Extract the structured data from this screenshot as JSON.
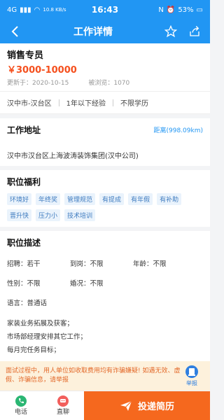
{
  "status": {
    "signal": "4G",
    "speed": "10.8 KB/s",
    "time": "16:43",
    "battery": "53%"
  },
  "nav": {
    "title": "工作详情"
  },
  "job": {
    "title": "销售专员",
    "salary": "￥3000-10000",
    "updated_label": "更新于：",
    "updated": "2020-10-15",
    "views_label": "被浏览：",
    "views": "1070",
    "tags": [
      "汉中市-汉台区",
      "1年以下经验",
      "不限学历"
    ]
  },
  "address": {
    "title": "工作地址",
    "distance": "距离(998.09km)",
    "text": "汉中市汉台区上海波涛装饰集团(汉中公司)"
  },
  "benefits": {
    "title": "职位福利",
    "items": [
      "环境好",
      "年终奖",
      "管理规范",
      "有提成",
      "有年假",
      "有补助",
      "晋升快",
      "压力小",
      "技术培训"
    ]
  },
  "description": {
    "title": "职位描述",
    "grid": [
      [
        "招聘：若干",
        "到岗：不限",
        "年龄：不限"
      ],
      [
        "性别：不限",
        "婚况：不限",
        ""
      ]
    ],
    "language": "语言：普通话",
    "duties": [
      "家装业务拓展及获客；",
      "市场部经理安排其它工作；",
      "每月完任务目标；"
    ]
  },
  "warning": {
    "text": "面试过程中，用人单位如收取费用均有诈骗嫌疑! 如遇无效、虚假、诈骗信息，请举报",
    "report": "举报"
  },
  "bottom": {
    "phone": "电话",
    "chat": "直聊",
    "apply": "投递简历"
  },
  "colors": {
    "primary": "#2196f3",
    "accent": "#f5681e",
    "salary": "#f5501e"
  }
}
